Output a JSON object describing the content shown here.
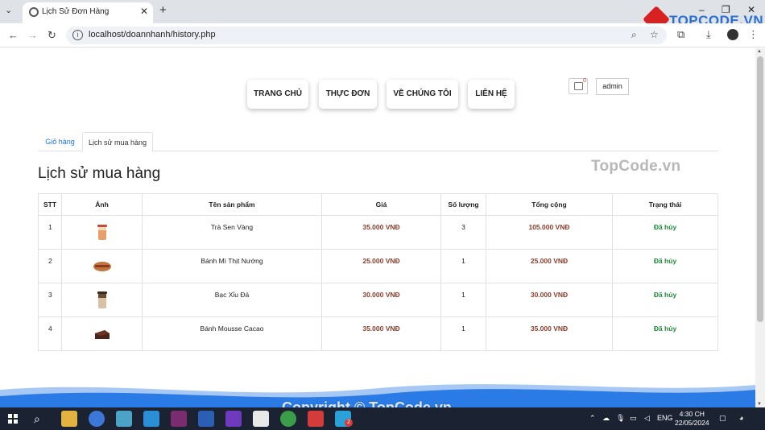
{
  "browser": {
    "tab_title": "Lịch Sử Đơn Hàng",
    "url": "localhost/doannhanh/history.php",
    "watermark_brand": "TOPCODE.VN"
  },
  "nav": {
    "items": [
      "TRANG CHỦ",
      "THỰC ĐƠN",
      "VỀ CHÚNG TÔI",
      "LIÊN HỆ"
    ],
    "cart_count": "0",
    "user": "admin"
  },
  "tabs": [
    "Giỏ hàng",
    "Lịch sử mua hàng"
  ],
  "heading": "Lịch sử mua hàng",
  "table": {
    "headers": [
      "STT",
      "Ảnh",
      "Tên sản phẩm",
      "Giá",
      "Số lượng",
      "Tổng cộng",
      "Trạng thái"
    ],
    "rows": [
      {
        "stt": "1",
        "image": "tea-cup-image",
        "name": "Trà Sen Vàng",
        "price": "35.000 VNĐ",
        "qty": "3",
        "total": "105.000 VNĐ",
        "status": "Đã hủy"
      },
      {
        "stt": "2",
        "image": "bread-image",
        "name": "Bánh Mì Thịt Nướng",
        "price": "25.000 VNĐ",
        "qty": "1",
        "total": "25.000 VNĐ",
        "status": "Đã hủy"
      },
      {
        "stt": "3",
        "image": "iced-coffee-image",
        "name": "Bạc Xỉu Đá",
        "price": "30.000 VNĐ",
        "qty": "1",
        "total": "30.000 VNĐ",
        "status": "Đã hủy"
      },
      {
        "stt": "4",
        "image": "cake-image",
        "name": "Bánh Mousse Cacao",
        "price": "35.000 VNĐ",
        "qty": "1",
        "total": "35.000 VNĐ",
        "status": "Đã hủy"
      }
    ]
  },
  "watermark_text": "TopCode.vn",
  "copyright": "Copyright © TopCode.vn",
  "taskbar": {
    "lang": "ENG",
    "time": "4:30 CH",
    "date": "22/05/2024",
    "badge": "2"
  },
  "colors": {
    "price": "#8c3d2b",
    "status": "#1e8a3a",
    "link": "#1a73e8",
    "wave": "#2b7be6"
  }
}
